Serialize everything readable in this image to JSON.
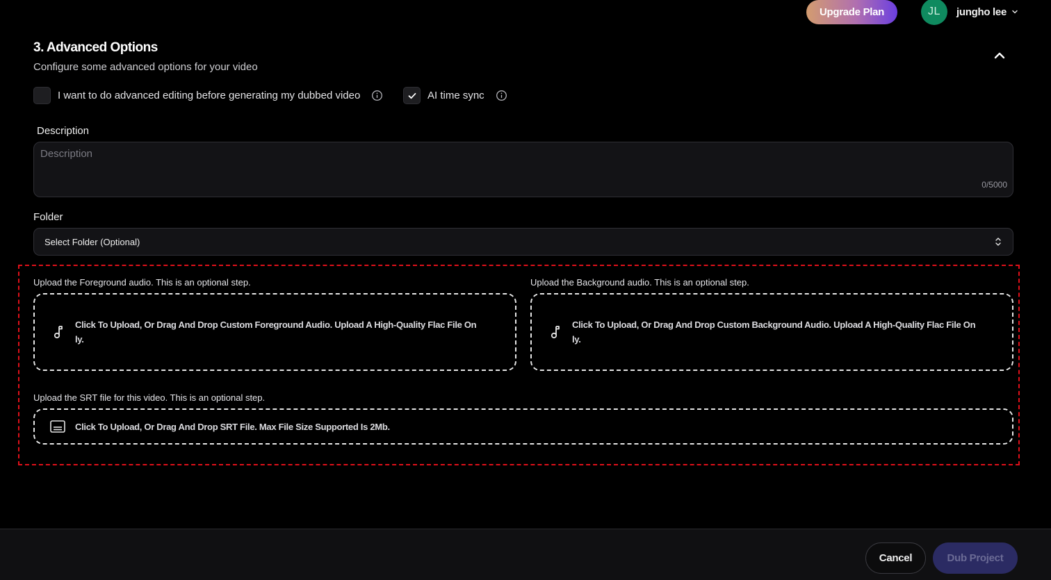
{
  "header": {
    "upgrade_label": "Upgrade Plan",
    "avatar_initials": "JL",
    "user_name": "jungho lee"
  },
  "section": {
    "title": "3. Advanced Options",
    "subtitle": "Configure some advanced options for your video"
  },
  "options": {
    "advanced_editing": {
      "label": "I want to do advanced editing before generating my dubbed video",
      "checked": false
    },
    "ai_time_sync": {
      "label": "AI time sync",
      "checked": true
    }
  },
  "description": {
    "label": "Description",
    "placeholder": "Description",
    "value": "",
    "counter": "0/5000"
  },
  "folder": {
    "label": "Folder",
    "selected": "Select Folder (Optional)"
  },
  "uploads": {
    "foreground": {
      "caption": "Upload the Foreground audio. This is an optional step.",
      "line1": "Click To Upload, Or Drag And Drop Custom Foreground Audio. Upload A High-Quality Flac File On",
      "line2": "ly."
    },
    "background": {
      "caption": "Upload the Background audio. This is an optional step.",
      "line1": "Click To Upload, Or Drag And Drop Custom Background Audio. Upload A High-Quality Flac File On",
      "line2": "ly."
    },
    "srt": {
      "caption": "Upload the SRT file for this video. This is an optional step.",
      "text": "Click To Upload, Or Drag And Drop SRT File. Max File Size Supported Is 2Mb."
    }
  },
  "footer": {
    "cancel_label": "Cancel",
    "submit_label": "Dub Project"
  },
  "colors": {
    "highlight": "#e0101a",
    "avatar_bg": "#0f8a5f",
    "submit_bg": "#2b2b63"
  }
}
